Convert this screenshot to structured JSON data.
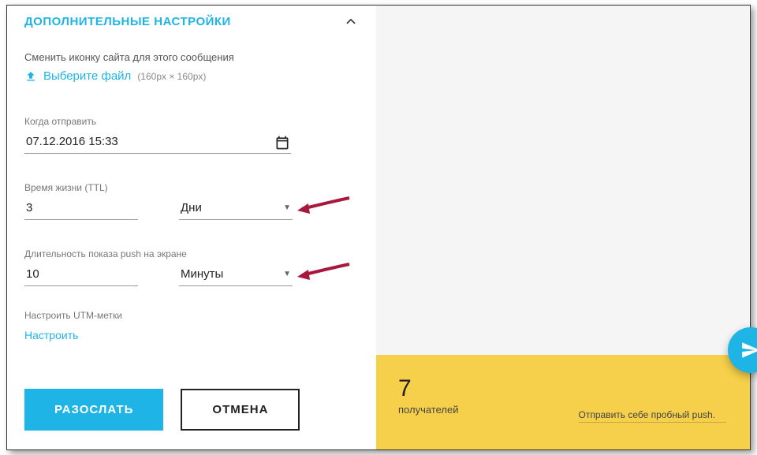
{
  "header": {
    "title": "ДОПОЛНИТЕЛЬНЫЕ НАСТРОЙКИ"
  },
  "icon_change": {
    "label": "Сменить иконку сайта для этого сообщения",
    "link_text": "Выберите файл",
    "hint": "(160px × 160px)"
  },
  "schedule": {
    "label": "Когда отправить",
    "value": "07.12.2016 15:33"
  },
  "ttl": {
    "label": "Время жизни (TTL)",
    "value": "3",
    "unit": "Дни"
  },
  "duration": {
    "label": "Длительность показа push на экране",
    "value": "10",
    "unit": "Минуты"
  },
  "utm": {
    "label": "Настроить UTM-метки",
    "link": "Настроить"
  },
  "buttons": {
    "send": "РАЗОСЛАТЬ",
    "cancel": "ОТМЕНА"
  },
  "footer": {
    "count": "7",
    "recipients_label": "получателей",
    "test_push": "Отправить себе пробный push."
  }
}
